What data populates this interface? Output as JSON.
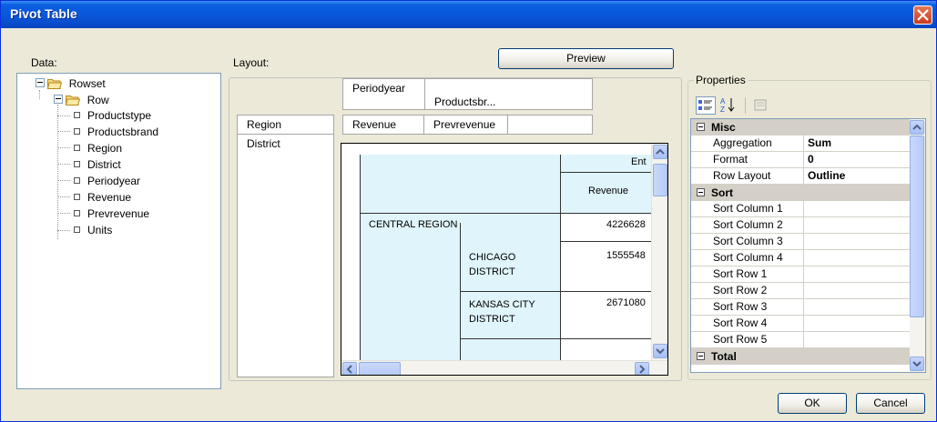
{
  "window": {
    "title": "Pivot Table"
  },
  "labels": {
    "data": "Data:",
    "layout": "Layout:",
    "properties": "Properties"
  },
  "buttons": {
    "preview": "Preview",
    "ok": "OK",
    "cancel": "Cancel"
  },
  "tree": {
    "root": "Rowset",
    "row": "Row",
    "fields": [
      "Productstype",
      "Productsbrand",
      "Region",
      "District",
      "Periodyear",
      "Revenue",
      "Prevrevenue",
      "Units"
    ]
  },
  "layout": {
    "column_fields": [
      "Periodyear",
      "Productsbr..."
    ],
    "row_fields": [
      "Region",
      "District"
    ],
    "measure_fields": [
      "Revenue",
      "Prevrevenue"
    ]
  },
  "preview_grid": {
    "header_top": "Ent",
    "header_measure": "Revenue",
    "rows": [
      {
        "region": "CENTRAL REGION",
        "district": "",
        "value": "4226628"
      },
      {
        "region": "",
        "district": "CHICAGO DISTRICT",
        "value": "1555548"
      },
      {
        "region": "",
        "district": "KANSAS CITY DISTRICT",
        "value": "2671080"
      }
    ]
  },
  "properties": {
    "categories": [
      {
        "name": "Misc",
        "items": [
          {
            "name": "Aggregation",
            "value": "Sum"
          },
          {
            "name": "Format",
            "value": "0"
          },
          {
            "name": "Row Layout",
            "value": "Outline"
          }
        ]
      },
      {
        "name": "Sort",
        "items": [
          {
            "name": "Sort Column 1",
            "value": ""
          },
          {
            "name": "Sort Column 2",
            "value": ""
          },
          {
            "name": "Sort Column 3",
            "value": ""
          },
          {
            "name": "Sort Column 4",
            "value": ""
          },
          {
            "name": "Sort Row 1",
            "value": ""
          },
          {
            "name": "Sort Row 2",
            "value": ""
          },
          {
            "name": "Sort Row 3",
            "value": ""
          },
          {
            "name": "Sort Row 4",
            "value": ""
          },
          {
            "name": "Sort Row 5",
            "value": ""
          }
        ]
      },
      {
        "name": "Total",
        "items": []
      }
    ]
  },
  "colors": {
    "titlebar": "#0a55d8",
    "grid_highlight": "#e0f4fb",
    "dialog_bg": "#ece9d8"
  }
}
